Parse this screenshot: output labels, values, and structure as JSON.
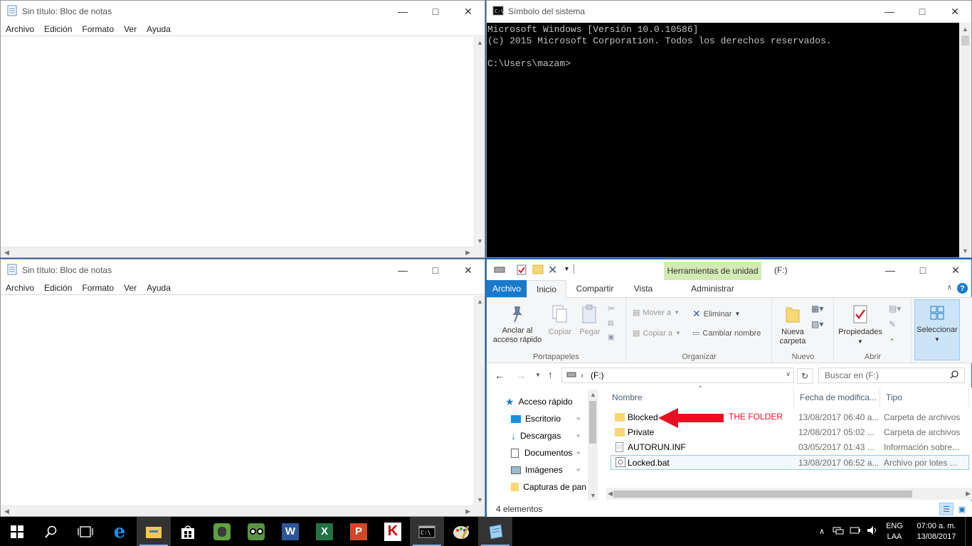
{
  "notepad_top": {
    "title": "Sin título: Bloc de notas",
    "menu": [
      "Archivo",
      "Edición",
      "Formato",
      "Ver",
      "Ayuda"
    ]
  },
  "notepad_bottom": {
    "title": "Sin título: Bloc de notas",
    "menu": [
      "Archivo",
      "Edición",
      "Formato",
      "Ver",
      "Ayuda"
    ]
  },
  "cmd": {
    "title": "Símbolo del sistema",
    "lines": [
      "Microsoft Windows [Versión 10.0.10586]",
      "(c) 2015 Microsoft Corporation. Todos los derechos reservados.",
      "",
      "C:\\Users\\mazam>"
    ]
  },
  "explorer": {
    "title": "(F:)",
    "contextual_tab_header": "Herramientas de unidad",
    "tabs": [
      "Archivo",
      "Inicio",
      "Compartir",
      "Vista",
      "Administrar"
    ],
    "ribbon": {
      "pin_label_1": "Anclar al",
      "pin_label_2": "acceso rápido",
      "copy_label": "Copiar",
      "paste_label": "Pegar",
      "group_clipboard": "Portapapeles",
      "move_to": "Mover a",
      "copy_to": "Copiar a",
      "delete": "Eliminar",
      "rename": "Cambiar nombre",
      "group_organize": "Organizar",
      "new_folder_1": "Nueva",
      "new_folder_2": "carpeta",
      "group_new": "Nuevo",
      "properties": "Propiedades",
      "group_open": "Abrir",
      "select": "Seleccionar"
    },
    "address": "(F:)",
    "search_placeholder": "Buscar en  (F:)",
    "nav": {
      "quick_access": "Acceso rápido",
      "items": [
        "Escritorio",
        "Descargas",
        "Documentos",
        "Imágenes",
        "Capturas de pan"
      ]
    },
    "columns": [
      "Nombre",
      "Fecha de modifica...",
      "Tipo"
    ],
    "files": [
      {
        "name": "Blocked",
        "date": "13/08/2017 06:40 a...",
        "type": "Carpeta de archivos",
        "icon": "folder-icon"
      },
      {
        "name": "Private",
        "date": "12/08/2017 05:02 ...",
        "type": "Carpeta de archivos",
        "icon": "folder-icon"
      },
      {
        "name": "AUTORUN.INF",
        "date": "03/05/2017 01:43 ...",
        "type": "Información sobre...",
        "icon": "document-icon"
      },
      {
        "name": "Locked.bat",
        "date": "13/08/2017 06:52 a...",
        "type": "Archivo por lotes ...",
        "icon": "batch-file-icon"
      }
    ],
    "annotation": "THE FOLDER",
    "status": "4 elementos",
    "accent": "#1979ca"
  },
  "taskbar": {
    "lang_1": "ENG",
    "lang_2": "LAA",
    "time": "07:00 a. m.",
    "date": "13/08/2017"
  }
}
